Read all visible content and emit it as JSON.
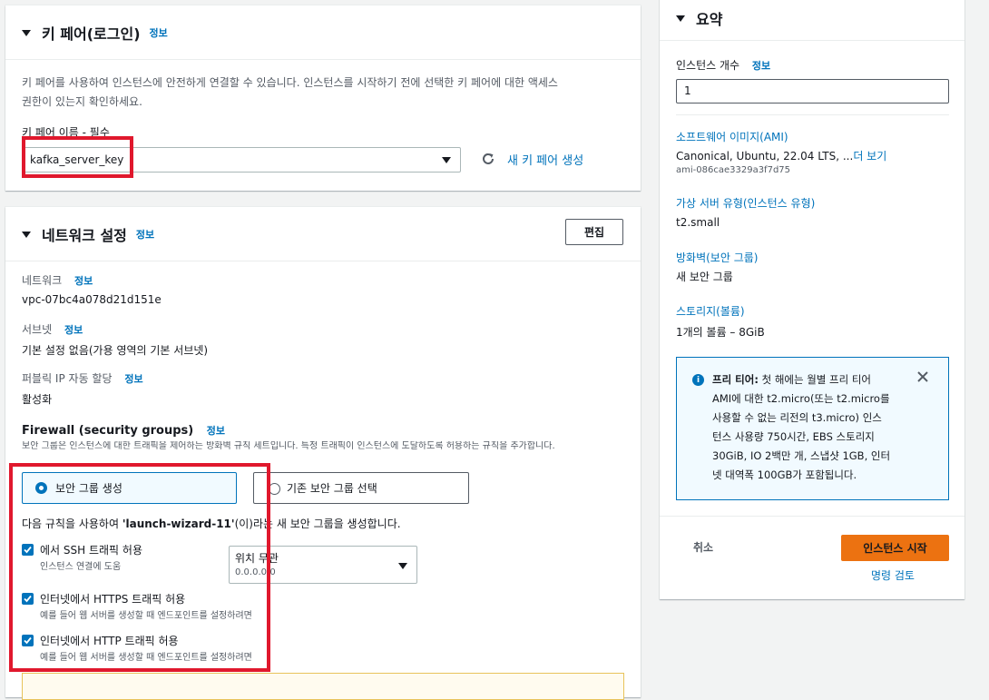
{
  "keypair": {
    "title": "키 페어(로그인)",
    "info": "정보",
    "description_line1": "키 페어를 사용하여 인스턴스에 안전하게 연결할 수 있습니다. 인스턴스를 시작하기 전에 선택한 키 페어에 대한 액세스",
    "description_line2": "권한이 있는지 확인하세요.",
    "name_label": "키 페어 이름 - 필수",
    "selected_value": "kafka_server_key",
    "create_new_label": "새 키 페어 생성"
  },
  "network": {
    "title": "네트워크 설정",
    "info": "정보",
    "edit_label": "편집",
    "network_label": "네트워크",
    "network_value": "vpc-07bc4a078d21d151e",
    "subnet_label": "서브넷",
    "subnet_value": "기본 설정 없음(가용 영역의 기본 서브넷)",
    "public_ip_label": "퍼블릭 IP 자동 할당",
    "public_ip_value": "활성화",
    "firewall_title": "Firewall (security groups)",
    "firewall_desc": "보안 그룹은 인스턴스에 대한 트래픽을 제어하는 방화벽 규칙 세트입니다. 특정 트래픽이 인스턴스에 도달하도록 허용하는 규칙을 추가합니다.",
    "option_create": "보안 그룹 생성",
    "option_existing": "기존 보안 그룹 선택",
    "rule_text_prefix": "다음 규칙을 사용하여 ",
    "rule_text_name": "'launch-wizard-11'",
    "rule_text_suffix": "(이)라는 새 보안 그룹을 생성합니다.",
    "rules": [
      {
        "label": "에서 SSH 트래픽 허용",
        "sub": "인스턴스 연결에 도움",
        "checked": true
      },
      {
        "label": "인터넷에서 HTTPS 트래픽 허용",
        "sub": "예를 들어 웹 서버를 생성할 때 엔드포인트를 설정하려면",
        "checked": true
      },
      {
        "label": "인터넷에서 HTTP 트래픽 허용",
        "sub": "예를 들어 웹 서버를 생성할 때 엔드포인트를 설정하려면",
        "checked": true
      }
    ],
    "source_select_label": "위치 무관",
    "source_select_value": "0.0.0.0/0"
  },
  "summary": {
    "title": "요약",
    "instance_count_label": "인스턴스 개수",
    "info": "정보",
    "instance_count_value": "1",
    "ami_label": "소프트웨어 이미지(AMI)",
    "ami_value": "Canonical, Ubuntu, 22.04 LTS, ...",
    "ami_more": "더 보기",
    "ami_id": "ami-086cae3329a3f7d75",
    "instance_type_label": "가상 서버 유형(인스턴스 유형)",
    "instance_type_value": "t2.small",
    "firewall_label": "방화벽(보안 그룹)",
    "firewall_value": "새 보안 그룹",
    "storage_label": "스토리지(볼륨)",
    "storage_value": "1개의 볼륨 – 8GiB",
    "free_tier_bold": "프리 티어:",
    "free_tier_lines": [
      " 첫 해에는 월별 프리 티어",
      "AMI에 대한 t2.micro(또는 t2.micro를",
      "사용할 수 없는 리전의 t3.micro) 인스",
      "턴스 사용량 750시간, EBS 스토리지",
      "30GiB, IO 2백만 개, 스냅샷 1GB, 인터",
      "넷 대역폭 100GB가 포함됩니다."
    ],
    "cancel_label": "취소",
    "launch_label": "인스턴스 시작",
    "review_label": "명령 검토"
  },
  "colors": {
    "accent": "#0073bb",
    "launch_button": "#ec7211",
    "highlight": "#e0182d"
  }
}
